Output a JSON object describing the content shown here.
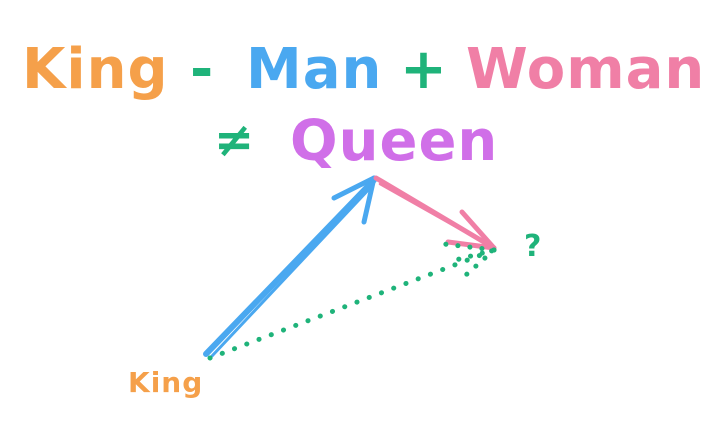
{
  "equation": {
    "king": "King",
    "minus": "-",
    "man": "Man",
    "plus": "+",
    "woman": "Woman",
    "not_equal": "≠",
    "queen": "Queen"
  },
  "diagram": {
    "king_label": "King",
    "question_label": "?"
  },
  "colors": {
    "king": "#f5a04a",
    "man": "#4aa8f0",
    "operator": "#1fb37a",
    "woman": "#f07fa6",
    "queen": "#d06fe8",
    "result_line": "#1fb37a",
    "background": "#ffffff"
  }
}
